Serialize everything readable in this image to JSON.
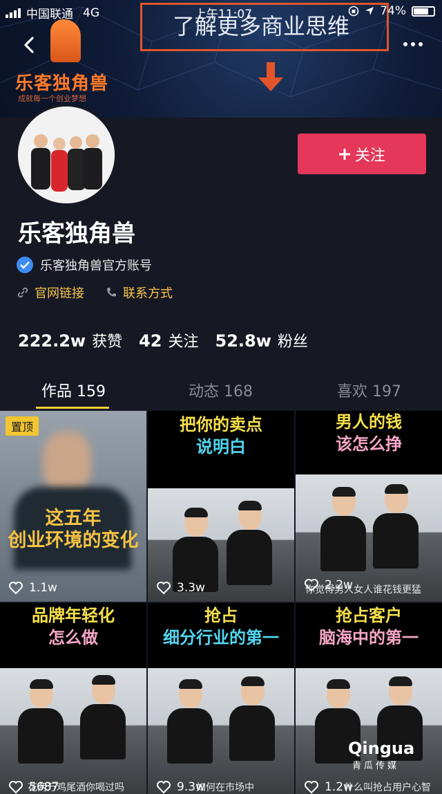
{
  "status_bar": {
    "carrier": "中国联通",
    "network": "4G",
    "time": "上午11:07",
    "battery": "74%",
    "battery_level": 0.74
  },
  "banner": {
    "logo_name": "乐客独角兽",
    "logo_slogan": "成就每一个创业梦想",
    "promo_text": "了解更多商业思维"
  },
  "profile": {
    "nickname": "乐客独角兽",
    "verified_label": "乐客独角兽官方账号",
    "follow_button": "关注",
    "links": [
      {
        "label": "官网链接",
        "icon": "link-icon"
      },
      {
        "label": "联系方式",
        "icon": "phone-icon"
      }
    ],
    "stats": [
      {
        "value": "222.2w",
        "label": "获赞"
      },
      {
        "value": "42",
        "label": "关注"
      },
      {
        "value": "52.8w",
        "label": "粉丝"
      }
    ]
  },
  "tabs": [
    {
      "label": "作品 159",
      "active": true
    },
    {
      "label": "动态 168",
      "active": false
    },
    {
      "label": "喜欢 197",
      "active": false
    }
  ],
  "videos": [
    {
      "title_lines": [
        "这五年",
        "创业环境的变化"
      ],
      "likes": "1.1w",
      "pinned_label": "置顶",
      "title_color": "#f6c343"
    },
    {
      "title_lines": [
        "把你的卖点",
        "说明白"
      ],
      "likes": "3.3w",
      "title_color": "#f6e04a",
      "title_color_2": "#52d6f0"
    },
    {
      "title_lines": [
        "男人的钱",
        "该怎么挣"
      ],
      "likes": "2.2w",
      "caption": "你觉得男人女人谁花钱更猛",
      "title_color": "#f6e04a",
      "title_color_2": "#f4a6c6"
    },
    {
      "title_lines": [
        "品牌年轻化",
        "怎么做"
      ],
      "likes": "5687",
      "caption": "花两万鸡尾酒你喝过吗",
      "title_color": "#f6e04a",
      "title_color_2": "#f4a6c6"
    },
    {
      "title_lines": [
        "抢占",
        "细分行业的第一"
      ],
      "likes": "9.3w",
      "caption": "如何在市场中",
      "title_color": "#f6e04a",
      "title_color_2": "#52d6f0"
    },
    {
      "title_lines": [
        "抢占客户",
        "脑海中的第一"
      ],
      "likes": "1.2w",
      "caption": "什么叫抢占用户心智",
      "title_color": "#f6e04a",
      "title_color_2": "#f4a6c6"
    }
  ],
  "watermark": {
    "brand": "Qingua",
    "sub": "青瓜传媒"
  },
  "colors": {
    "background": "#161823",
    "follow": "#e5375a",
    "link": "#f7c44e",
    "tab_underline": "#f4cf33",
    "verified": "#3d8cf0"
  }
}
